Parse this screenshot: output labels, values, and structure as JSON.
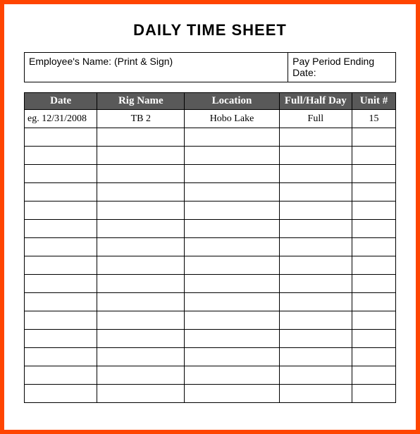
{
  "title": "DAILY TIME SHEET",
  "info": {
    "employee_label": "Employee's Name: (Print & Sign)",
    "pay_period_label": "Pay Period Ending Date:"
  },
  "columns": {
    "date": "Date",
    "rig": "Rig Name",
    "location": "Location",
    "day": "Full/Half Day",
    "unit": "Unit #"
  },
  "rows": [
    {
      "date": "eg. 12/31/2008",
      "rig": "TB 2",
      "location": "Hobo Lake",
      "day": "Full",
      "unit": "15"
    },
    {
      "date": "",
      "rig": "",
      "location": "",
      "day": "",
      "unit": ""
    },
    {
      "date": "",
      "rig": "",
      "location": "",
      "day": "",
      "unit": ""
    },
    {
      "date": "",
      "rig": "",
      "location": "",
      "day": "",
      "unit": ""
    },
    {
      "date": "",
      "rig": "",
      "location": "",
      "day": "",
      "unit": ""
    },
    {
      "date": "",
      "rig": "",
      "location": "",
      "day": "",
      "unit": ""
    },
    {
      "date": "",
      "rig": "",
      "location": "",
      "day": "",
      "unit": ""
    },
    {
      "date": "",
      "rig": "",
      "location": "",
      "day": "",
      "unit": ""
    },
    {
      "date": "",
      "rig": "",
      "location": "",
      "day": "",
      "unit": ""
    },
    {
      "date": "",
      "rig": "",
      "location": "",
      "day": "",
      "unit": ""
    },
    {
      "date": "",
      "rig": "",
      "location": "",
      "day": "",
      "unit": ""
    },
    {
      "date": "",
      "rig": "",
      "location": "",
      "day": "",
      "unit": ""
    },
    {
      "date": "",
      "rig": "",
      "location": "",
      "day": "",
      "unit": ""
    },
    {
      "date": "",
      "rig": "",
      "location": "",
      "day": "",
      "unit": ""
    },
    {
      "date": "",
      "rig": "",
      "location": "",
      "day": "",
      "unit": ""
    },
    {
      "date": "",
      "rig": "",
      "location": "",
      "day": "",
      "unit": ""
    }
  ]
}
